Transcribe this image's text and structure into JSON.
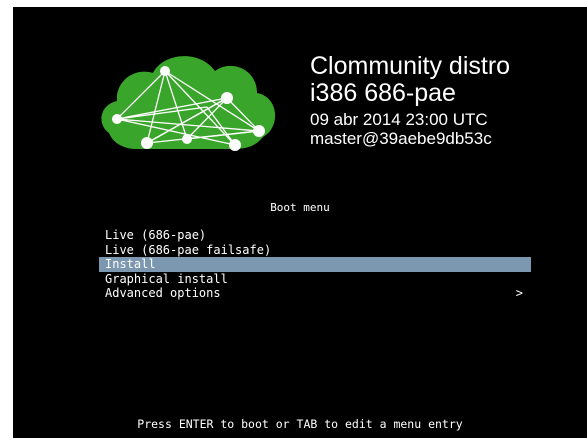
{
  "header": {
    "title_line1": "Clommunity distro",
    "title_line2": "i386 686-pae",
    "build_date": "09 abr 2014 23:00 UTC",
    "build_id": "master@39aebe9db53c"
  },
  "logo": {
    "icon": "clommunity-cloud-network-logo",
    "color": "#3aa52b"
  },
  "menu": {
    "title": "Boot menu",
    "items": [
      {
        "label": "Live (686-pae)",
        "selected": false,
        "submenu": ""
      },
      {
        "label": "Live (686-pae failsafe)",
        "selected": false,
        "submenu": ""
      },
      {
        "label": "Install",
        "selected": true,
        "submenu": ""
      },
      {
        "label": "Graphical install",
        "selected": false,
        "submenu": ""
      },
      {
        "label": "Advanced options",
        "selected": false,
        "submenu": ">"
      }
    ],
    "highlight_color": "#7c97b0"
  },
  "footer": {
    "hint": "Press ENTER to boot or TAB to edit a menu entry"
  }
}
